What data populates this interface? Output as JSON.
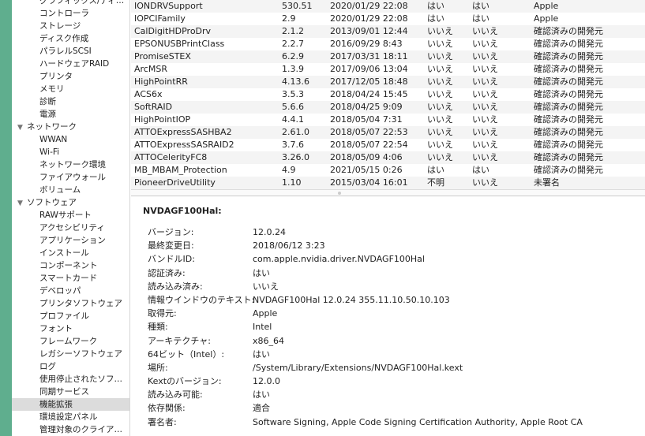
{
  "sidebar": {
    "items": [
      {
        "label": "グラフィックス/ディ…",
        "group": false
      },
      {
        "label": "コントローラ"
      },
      {
        "label": "ストレージ"
      },
      {
        "label": "ディスク作成"
      },
      {
        "label": "パラレルSCSI"
      },
      {
        "label": "ハードウェアRAID"
      },
      {
        "label": "プリンタ"
      },
      {
        "label": "メモリ"
      },
      {
        "label": "診断"
      },
      {
        "label": "電源"
      },
      {
        "label": "ネットワーク",
        "group": true
      },
      {
        "label": "WWAN"
      },
      {
        "label": "Wi-Fi"
      },
      {
        "label": "ネットワーク環境"
      },
      {
        "label": "ファイアウォール"
      },
      {
        "label": "ボリューム"
      },
      {
        "label": "ソフトウェア",
        "group": true
      },
      {
        "label": "RAWサポート"
      },
      {
        "label": "アクセシビリティ"
      },
      {
        "label": "アプリケーション"
      },
      {
        "label": "インストール"
      },
      {
        "label": "コンポーネント"
      },
      {
        "label": "スマートカード"
      },
      {
        "label": "デベロッパ"
      },
      {
        "label": "プリンタソフトウェア"
      },
      {
        "label": "プロファイル"
      },
      {
        "label": "フォント"
      },
      {
        "label": "フレームワーク"
      },
      {
        "label": "レガシーソフトウェア"
      },
      {
        "label": "ログ"
      },
      {
        "label": "使用停止されたソフ…"
      },
      {
        "label": "同期サービス"
      },
      {
        "label": "機能拡張",
        "selected": true
      },
      {
        "label": "環境設定パネル"
      },
      {
        "label": "管理対象のクライア…"
      }
    ]
  },
  "table": {
    "rows": [
      [
        "IONDRVSupport",
        "530.51",
        "2020/01/29 22:08",
        "はい",
        "はい",
        "Apple"
      ],
      [
        "IOPCIFamily",
        "2.9",
        "2020/01/29 22:08",
        "はい",
        "はい",
        "Apple"
      ],
      [
        "CalDigitHDProDrv",
        "2.1.2",
        "2013/09/01 12:44",
        "いいえ",
        "いいえ",
        "確認済みの開発元"
      ],
      [
        "EPSONUSBPrintClass",
        "2.2.7",
        "2016/09/29 8:43",
        "いいえ",
        "いいえ",
        "確認済みの開発元"
      ],
      [
        "PromiseSTEX",
        "6.2.9",
        "2017/03/31 18:11",
        "いいえ",
        "いいえ",
        "確認済みの開発元"
      ],
      [
        "ArcMSR",
        "1.3.9",
        "2017/09/06 13:04",
        "いいえ",
        "いいえ",
        "確認済みの開発元"
      ],
      [
        "HighPointRR",
        "4.13.6",
        "2017/12/05 18:48",
        "いいえ",
        "いいえ",
        "確認済みの開発元"
      ],
      [
        "ACS6x",
        "3.5.3",
        "2018/04/24 15:45",
        "いいえ",
        "いいえ",
        "確認済みの開発元"
      ],
      [
        "SoftRAID",
        "5.6.6",
        "2018/04/25 9:09",
        "いいえ",
        "いいえ",
        "確認済みの開発元"
      ],
      [
        "HighPointIOP",
        "4.4.1",
        "2018/05/04 7:31",
        "いいえ",
        "いいえ",
        "確認済みの開発元"
      ],
      [
        "ATTOExpressSASHBA2",
        "2.61.0",
        "2018/05/07 22:53",
        "いいえ",
        "いいえ",
        "確認済みの開発元"
      ],
      [
        "ATTOExpressSASRAID2",
        "3.7.6",
        "2018/05/07 22:54",
        "いいえ",
        "いいえ",
        "確認済みの開発元"
      ],
      [
        "ATTOCelerityFC8",
        "3.26.0",
        "2018/05/09 4:06",
        "いいえ",
        "いいえ",
        "確認済みの開発元"
      ],
      [
        "MB_MBAM_Protection",
        "4.9",
        "2021/05/15 0:26",
        "はい",
        "はい",
        "確認済みの開発元"
      ],
      [
        "PioneerDriveUtility",
        "1.10",
        "2015/03/04 16:01",
        "不明",
        "いいえ",
        "未署名"
      ]
    ]
  },
  "detail": {
    "title": "NVDAGF100Hal:",
    "rows": [
      [
        "バージョン:",
        "12.0.24"
      ],
      [
        "最終変更日:",
        "2018/06/12 3:23"
      ],
      [
        "バンドルID:",
        "com.apple.nvidia.driver.NVDAGF100Hal"
      ],
      [
        "認証済み:",
        "はい"
      ],
      [
        "読み込み済み:",
        "いいえ"
      ],
      [
        "情報ウインドウのテキスト:",
        "NVDAGF100Hal 12.0.24 355.11.10.50.10.103"
      ],
      [
        "取得元:",
        "Apple"
      ],
      [
        "種類:",
        "Intel"
      ],
      [
        "アーキテクチャ:",
        "x86_64"
      ],
      [
        "64ビット（Intel）:",
        "はい"
      ],
      [
        "場所:",
        "/System/Library/Extensions/NVDAGF100Hal.kext"
      ],
      [
        "Kextのバージョン:",
        "12.0.0"
      ],
      [
        "読み込み可能:",
        "はい"
      ],
      [
        "依存関係:",
        "適合"
      ],
      [
        "署名者:",
        "Software Signing, Apple Code Signing Certification Authority, Apple Root CA"
      ]
    ]
  },
  "icons": {
    "disclosure": "▼"
  }
}
